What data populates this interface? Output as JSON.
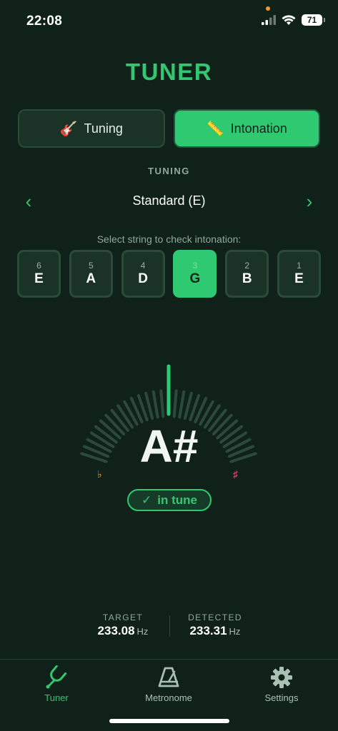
{
  "status": {
    "time": "22:08",
    "battery": "71"
  },
  "header": {
    "title": "TUNER"
  },
  "mode_toggle": [
    {
      "label": "Tuning",
      "emoji": "🎸",
      "active": false
    },
    {
      "label": "Intonation",
      "emoji": "📏",
      "active": true
    }
  ],
  "tuning": {
    "section_label": "TUNING",
    "name": "Standard (E)",
    "prev": "‹",
    "next": "›"
  },
  "strings": {
    "hint": "Select string to check intonation:",
    "items": [
      {
        "number": "6",
        "note": "E"
      },
      {
        "number": "5",
        "note": "A"
      },
      {
        "number": "4",
        "note": "D"
      },
      {
        "number": "3",
        "note": "G",
        "selected": true
      },
      {
        "number": "2",
        "note": "B"
      },
      {
        "number": "1",
        "note": "E"
      }
    ]
  },
  "meter": {
    "note": "A#",
    "flat_symbol": "♭",
    "sharp_symbol": "♯",
    "status": "in tune",
    "check": "✓"
  },
  "frequencies": {
    "target_label": "TARGET",
    "target_value": "233.08",
    "target_unit": "Hz",
    "detected_label": "DETECTED",
    "detected_value": "233.31",
    "detected_unit": "Hz"
  },
  "tabbar": {
    "tuner": "Tuner",
    "metronome": "Metronome",
    "settings": "Settings"
  },
  "colors": {
    "accent": "#2ec970",
    "background": "#0f2119",
    "flat": "#e8a62e",
    "sharp": "#e04d77"
  }
}
